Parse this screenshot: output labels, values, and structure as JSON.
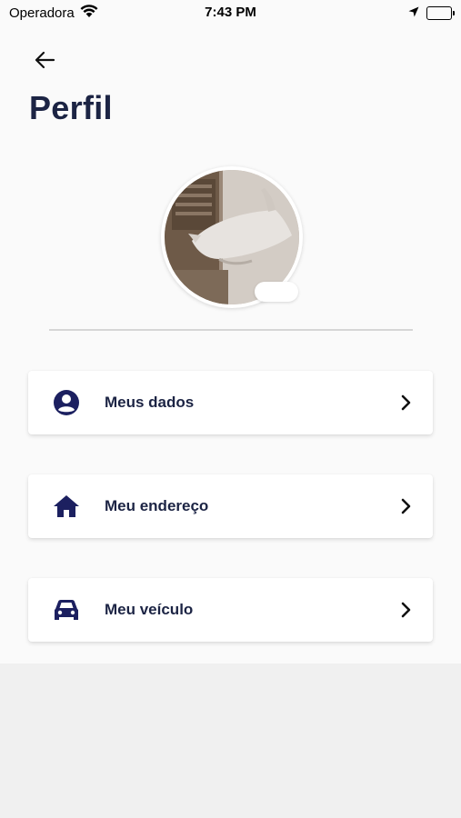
{
  "status_bar": {
    "carrier": "Operadora",
    "time": "7:43 PM"
  },
  "header": {
    "title": "Perfil"
  },
  "menu": {
    "items": [
      {
        "label": "Meus dados",
        "icon": "account-circle-icon"
      },
      {
        "label": "Meu endereço",
        "icon": "home-icon"
      },
      {
        "label": "Meu veículo",
        "icon": "car-icon"
      }
    ]
  },
  "colors": {
    "text_primary": "#1c2444",
    "background": "#fafafa",
    "card": "#ffffff"
  }
}
